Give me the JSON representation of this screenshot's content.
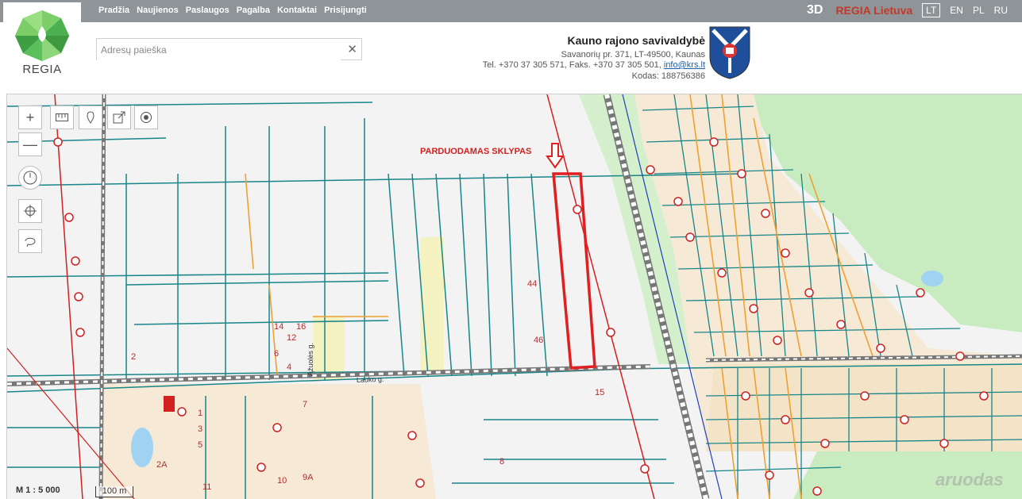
{
  "nav": [
    "Pradžia",
    "Naujienos",
    "Paslaugos",
    "Pagalba",
    "Kontaktai",
    "Prisijungti"
  ],
  "right_nav": {
    "btn3d": "3D",
    "regia": "REGIA Lietuva",
    "langs": [
      "LT",
      "EN",
      "PL",
      "RU"
    ],
    "active_lang": "LT"
  },
  "logo": {
    "text": "REGIA"
  },
  "search": {
    "placeholder": "Adresų paieška",
    "clear": "✕"
  },
  "municipality": {
    "name": "Kauno rajono savivaldybė",
    "address": "Savanorių pr. 371, LT-49500, Kaunas",
    "phone": "Tel. +370 37 305 571, Faks. +370 37 305 501, ",
    "email": "info@krs.lt",
    "code": "Kodas: 188756386"
  },
  "map": {
    "annotation": "PARDUODAMAS SKLYPAS",
    "street_labels": [
      "Lauko g.",
      "Ąžuolės g."
    ],
    "parcel_numbers": [
      "44",
      "46",
      "15",
      "2",
      "8",
      "14",
      "16",
      "12",
      "6",
      "4",
      "2A",
      "9A",
      "10",
      "11",
      "5",
      "3",
      "1",
      "7"
    ],
    "highlight_color": "#e02020"
  },
  "scale": {
    "ratio": "M 1 : 5 000",
    "bar": "100 m"
  },
  "watermark": "aruodas"
}
